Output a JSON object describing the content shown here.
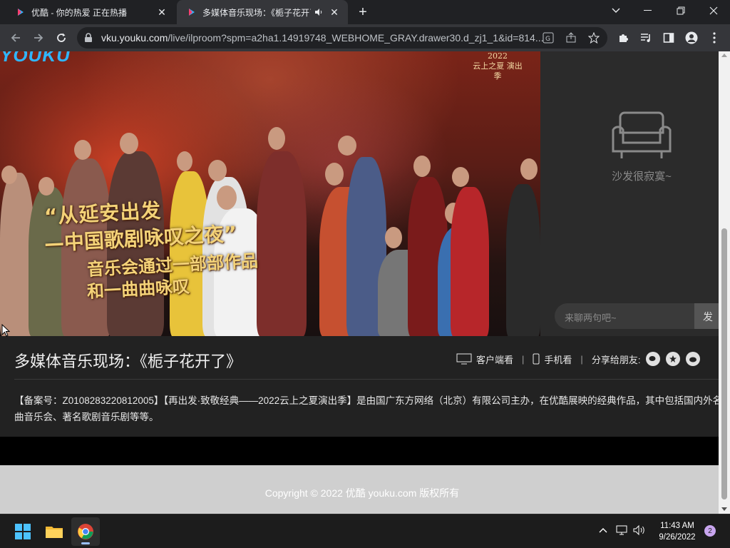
{
  "browser": {
    "tabs": [
      {
        "title": "优酷 - 你的热爱 正在热播",
        "active": false
      },
      {
        "title": "多媒体音乐现场：《栀子花开了》",
        "active": true
      }
    ],
    "url_host": "vku.youku.com",
    "url_path": "/live/ilproom?spm=a2ha1.14919748_WEBHOME_GRAY.drawer30.d_zj1_1&id=814..."
  },
  "video": {
    "logo_text": "YOUKU",
    "badge_year": "2022",
    "badge_text": "云上之夏 演出季",
    "caption": {
      "line1": "“从延安出发",
      "line2": "—中国歌剧咏叹之夜”",
      "line3": "音乐会通过一部部作品",
      "line4": "和一曲曲咏叹"
    }
  },
  "chat": {
    "empty_text": "沙发很寂寞~",
    "input_placeholder": "来聊两句吧~",
    "send_label": "发"
  },
  "info": {
    "title": "多媒体音乐现场：《栀子花开了》",
    "client_watch": "客户端看",
    "mobile_watch": "手机看",
    "share_label": "分享给朋友:",
    "description": "【备案号：Z0108283220812005】【再出发·致敬经典——2022云上之夏演出季】是由国广东方网络（北京）有限公司主办，在优酷展映的经典作品，其中包括国内外名曲音乐会、著名歌剧音乐剧等等。"
  },
  "footer": {
    "copyright": "Copyright © 2022 优酷 youku.com 版权所有"
  },
  "taskbar": {
    "time": "11:43 AM",
    "date": "9/26/2022",
    "notification_count": "2"
  },
  "colors": {
    "tab_active": "#35363a",
    "omnibox": "#202124",
    "caption_gold": "#f3d278",
    "youku_blue": "#2fb6ff",
    "footer_bg": "#cfcfcf"
  }
}
